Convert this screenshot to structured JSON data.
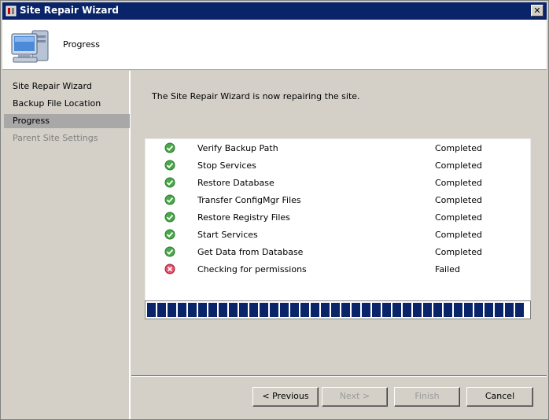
{
  "window": {
    "title": "Site Repair Wizard",
    "close_label": "✕"
  },
  "header": {
    "title": "Progress",
    "icon": "computer-icon"
  },
  "sidebar": {
    "items": [
      {
        "label": "Site Repair Wizard",
        "state": "normal"
      },
      {
        "label": "Backup File Location",
        "state": "normal"
      },
      {
        "label": "Progress",
        "state": "active"
      },
      {
        "label": "Parent Site Settings",
        "state": "disabled"
      }
    ]
  },
  "main": {
    "intro": "The Site Repair Wizard is now repairing the site.",
    "tasks": [
      {
        "name": "Verify Backup Path",
        "status": "Completed",
        "icon": "success-check-icon"
      },
      {
        "name": "Stop Services",
        "status": "Completed",
        "icon": "success-check-icon"
      },
      {
        "name": "Restore Database",
        "status": "Completed",
        "icon": "success-check-icon"
      },
      {
        "name": "Transfer ConfigMgr Files",
        "status": "Completed",
        "icon": "success-check-icon"
      },
      {
        "name": "Restore Registry Files",
        "status": "Completed",
        "icon": "success-check-icon"
      },
      {
        "name": "Start Services",
        "status": "Completed",
        "icon": "success-check-icon"
      },
      {
        "name": "Get Data from Database",
        "status": "Completed",
        "icon": "success-check-icon"
      },
      {
        "name": "Checking for permissions",
        "status": "Failed",
        "icon": "error-x-icon"
      }
    ],
    "progress_fraction": 1.0
  },
  "buttons": {
    "previous": "< Previous",
    "next": "Next >",
    "finish": "Finish",
    "cancel": "Cancel"
  },
  "colors": {
    "titlebar": "#0a246a",
    "progress_block": "#0a246a",
    "success": "#3a9a3a",
    "error": "#c0283a"
  }
}
